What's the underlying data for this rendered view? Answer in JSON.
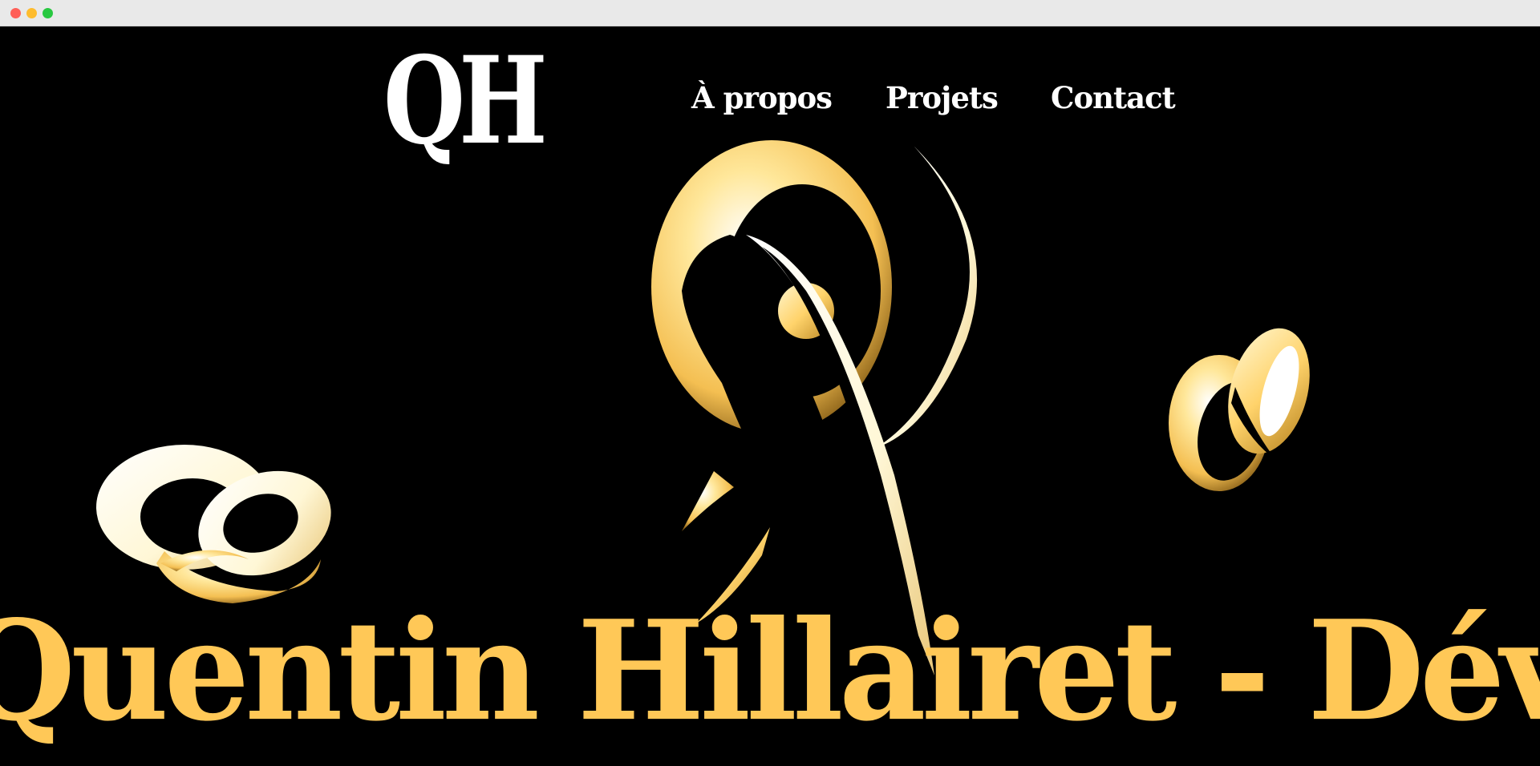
{
  "logo": {
    "text": "QH"
  },
  "nav": {
    "items": [
      {
        "label": "À propos"
      },
      {
        "label": "Projets"
      },
      {
        "label": "Contact"
      }
    ]
  },
  "hero": {
    "marquee_text": "Quentin Hillairet - Développeur"
  },
  "colors": {
    "background": "#000000",
    "accent": "#ffc857",
    "text": "#ffffff"
  }
}
